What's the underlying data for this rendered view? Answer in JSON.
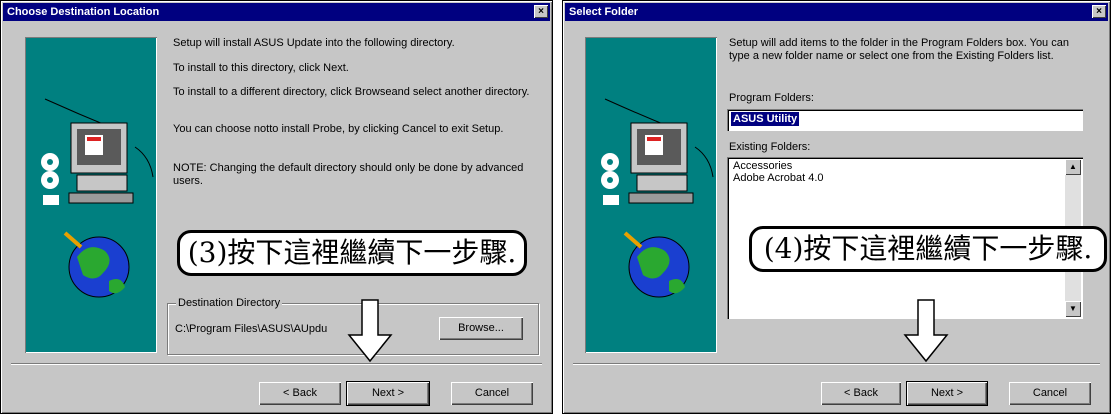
{
  "dialog1": {
    "title": "Choose Destination Location",
    "close_label": "×",
    "paragraphs": [
      "Setup will install ASUS Update into the following directory.",
      "To install to this directory, click Next.",
      "To install to a different directory, click Browseand select another directory.",
      "You can choose notto install Probe, by clicking Cancel to exit Setup.",
      "NOTE:  Changing the default directory should only be done by advanced users."
    ],
    "group_label": "Destination Directory",
    "path": "C:\\Program Files\\ASUS\\AUpdu",
    "browse_label": "Browse...",
    "back_label": "< Back",
    "next_label": "Next >",
    "cancel_label": "Cancel",
    "callout": "(3)按下這裡繼續下一步驟."
  },
  "dialog2": {
    "title": "Select Folder",
    "close_label": "×",
    "instruction": "Setup will add items to the folder in the Program Folders box. You can type a new folder name or select one from the Existing Folders list.",
    "program_folders_label": "Program Folders:",
    "program_folder_value": "ASUS Utility",
    "existing_folders_label": "Existing Folders:",
    "existing_folders": [
      "Accessories",
      "Adobe Acrobat 4.0"
    ],
    "back_label": "< Back",
    "next_label": "Next >",
    "cancel_label": "Cancel",
    "callout": "(4)按下這裡繼續下一步驟."
  },
  "icons": [
    "close-icon",
    "computer-icon",
    "globe-icon",
    "disc-icon",
    "down-arrow-icon",
    "scroll-up-icon",
    "scroll-down-icon"
  ],
  "colors": {
    "titlebar": "#000080",
    "dialog": "#c6c6c6",
    "art_panel": "#008080",
    "selection": "#000080"
  }
}
